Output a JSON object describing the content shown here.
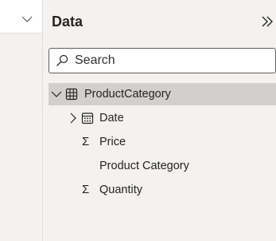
{
  "pane": {
    "title": "Data",
    "search": {
      "placeholder": "Search"
    },
    "tree": {
      "table_name": "ProductCategory",
      "fields": [
        {
          "label": "Date",
          "icon": "calendar-icon",
          "expandable": true
        },
        {
          "label": "Price",
          "icon": "sigma-icon",
          "expandable": false
        },
        {
          "label": "Product Category",
          "icon": "",
          "expandable": false
        },
        {
          "label": "Quantity",
          "icon": "sigma-icon",
          "expandable": false
        }
      ]
    },
    "sigma_glyph": "Σ"
  },
  "colors": {
    "background": "#f3f2f1",
    "selected_row": "#d2d0ce",
    "text": "#252423",
    "border": "#605e5c"
  }
}
